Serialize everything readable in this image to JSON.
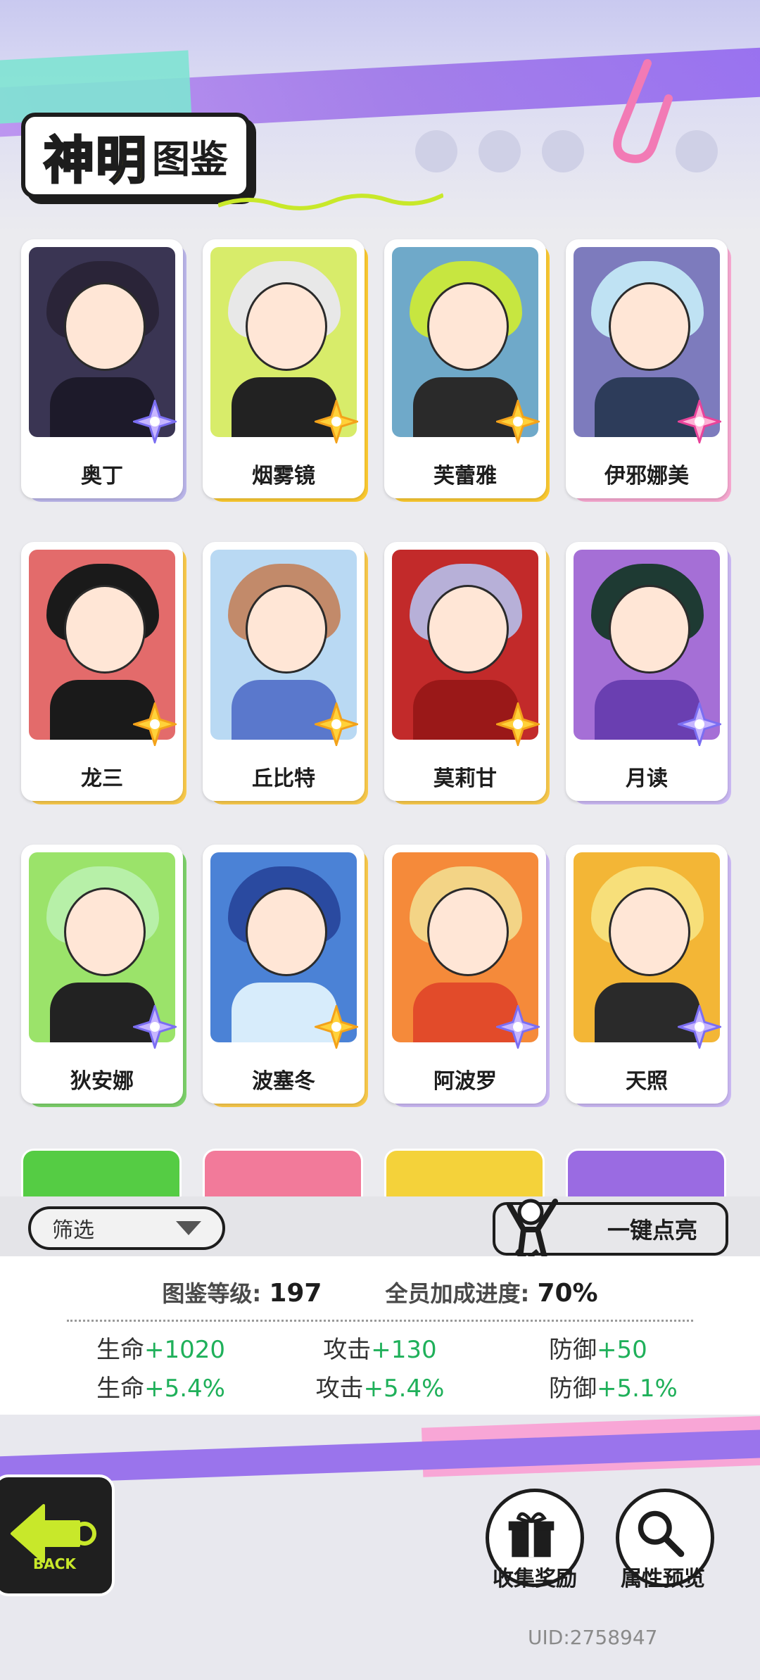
{
  "page": {
    "title_main": "神明",
    "title_sub": "图鉴"
  },
  "cards": [
    {
      "name": "奥丁",
      "bg": "#3a3553",
      "hair": "#2a2438",
      "body": "#1d1a2a",
      "back": "#b9b4e8",
      "badge": "purple"
    },
    {
      "name": "烟雾镜",
      "bg": "#d8ec6a",
      "hair": "#e8e8e8",
      "body": "#222222",
      "back": "#f9c830",
      "badge": "gold"
    },
    {
      "name": "芙蕾雅",
      "bg": "#6fa9c9",
      "hair": "#c7e640",
      "body": "#2a2a2a",
      "back": "#f9c830",
      "badge": "gold"
    },
    {
      "name": "伊邪娜美",
      "bg": "#7d7bbd",
      "hair": "#bfe2f3",
      "body": "#2d3c5a",
      "back": "#f5a7cf",
      "badge": "pink"
    },
    {
      "name": "龙三",
      "bg": "#e36b6b",
      "hair": "#1a1a1a",
      "body": "#1a1a1a",
      "back": "#f7c84a",
      "badge": "gold"
    },
    {
      "name": "丘比特",
      "bg": "#b9d9f3",
      "hair": "#c28a6a",
      "body": "#5a78cc",
      "back": "#f7c84a",
      "badge": "gold"
    },
    {
      "name": "莫莉甘",
      "bg": "#c22a2a",
      "hair": "#b7b0d8",
      "body": "#9a1818",
      "back": "#f7c84a",
      "badge": "gold"
    },
    {
      "name": "月读",
      "bg": "#a56fd6",
      "hair": "#1e3a33",
      "body": "#6a3fb1",
      "back": "#c9b7f2",
      "badge": "purple"
    },
    {
      "name": "狄安娜",
      "bg": "#9be36a",
      "hair": "#b7f0a8",
      "body": "#222222",
      "back": "#7cd06a",
      "badge": "purple"
    },
    {
      "name": "波塞冬",
      "bg": "#4b82d6",
      "hair": "#2a4aa0",
      "body": "#d7ecfb",
      "back": "#f7c84a",
      "badge": "gold"
    },
    {
      "name": "阿波罗",
      "bg": "#f58a3a",
      "hair": "#f3d486",
      "body": "#e24b2a",
      "back": "#c9b7f2",
      "badge": "purple"
    },
    {
      "name": "天照",
      "bg": "#f3b636",
      "hair": "#f7df7a",
      "body": "#2a2a2a",
      "back": "#c9b7f2",
      "badge": "purple"
    }
  ],
  "partial_cards": [
    "#55cc44",
    "#f27a9a",
    "#f4d23a",
    "#9a6be2"
  ],
  "filter": {
    "label": "筛选"
  },
  "light_up": {
    "label": "一键点亮"
  },
  "stats": {
    "level_label": "图鉴等级:",
    "level_value": "197",
    "progress_label": "全员加成进度:",
    "progress_value": "70%"
  },
  "bonuses": [
    {
      "stat": "生命",
      "value": "+1020"
    },
    {
      "stat": "攻击",
      "value": "+130"
    },
    {
      "stat": "防御",
      "value": "+50"
    },
    {
      "stat": "生命",
      "value": "+5.4%"
    },
    {
      "stat": "攻击",
      "value": "+5.4%"
    },
    {
      "stat": "防御",
      "value": "+5.1%"
    }
  ],
  "bottom": {
    "back_label": "BACK",
    "collect_label": "收集奖励",
    "preview_label": "属性预览",
    "uid": "UID:2758947"
  }
}
